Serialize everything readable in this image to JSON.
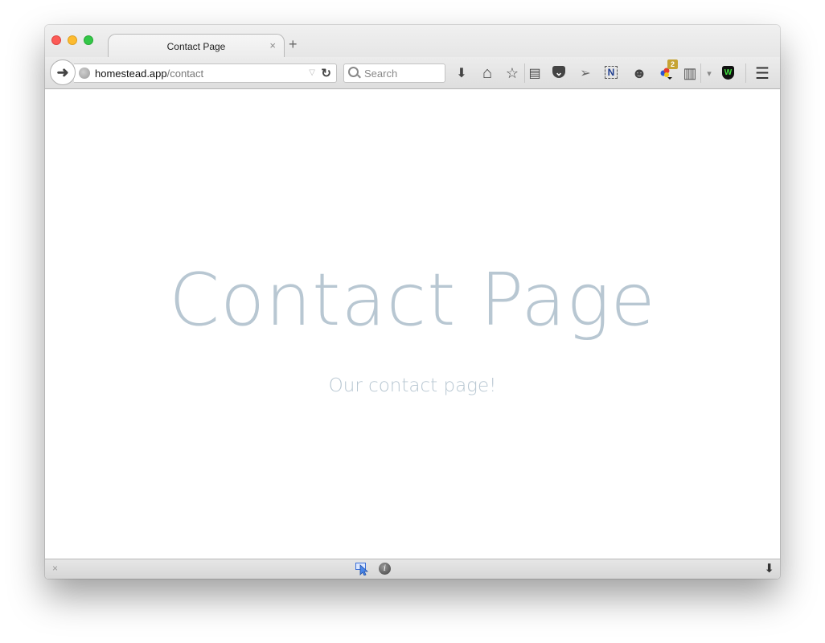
{
  "window": {
    "tab": {
      "title": "Contact Page",
      "close_glyph": "×"
    },
    "new_tab_glyph": "+"
  },
  "navbar": {
    "back_glyph": "🡐",
    "url_host": "homestead.app",
    "url_path": "/contact",
    "url_dropdown_glyph": "▽",
    "reload_glyph": "↻",
    "search_placeholder": "Search",
    "toolbar_icons": [
      {
        "name": "downloads-icon",
        "glyph": "⬇"
      },
      {
        "name": "home-icon",
        "glyph": "⌂"
      },
      {
        "name": "bookmark-star-icon",
        "glyph": "☆"
      },
      {
        "name": "bookmarks-menu-icon",
        "glyph": "▤"
      },
      {
        "name": "pocket-icon",
        "glyph": "⌄"
      },
      {
        "name": "send-icon",
        "glyph": "➢"
      },
      {
        "name": "onenote-clipper-icon",
        "glyph": "N"
      },
      {
        "name": "emoji-icon",
        "glyph": "☻"
      },
      {
        "name": "colorful-dots-extension-icon",
        "glyph": "●"
      },
      {
        "name": "clipboard-icon",
        "glyph": "▥"
      },
      {
        "name": "dropdown-arrow-icon",
        "glyph": "▾"
      },
      {
        "name": "shield-extension-icon",
        "glyph": "W"
      },
      {
        "name": "hamburger-menu-icon",
        "glyph": "☰"
      }
    ],
    "badge_count": "2",
    "colors": {
      "shield": "#1c9b1c",
      "badge": "#c6a333",
      "onenote": "#1e3d8f"
    }
  },
  "page": {
    "title": "Contact Page",
    "subtitle": "Our contact page!",
    "text_color": "#b8c7d2"
  },
  "statusbar": {
    "close_glyph": "×",
    "info_glyph": "i",
    "download_glyph": "⬇"
  }
}
